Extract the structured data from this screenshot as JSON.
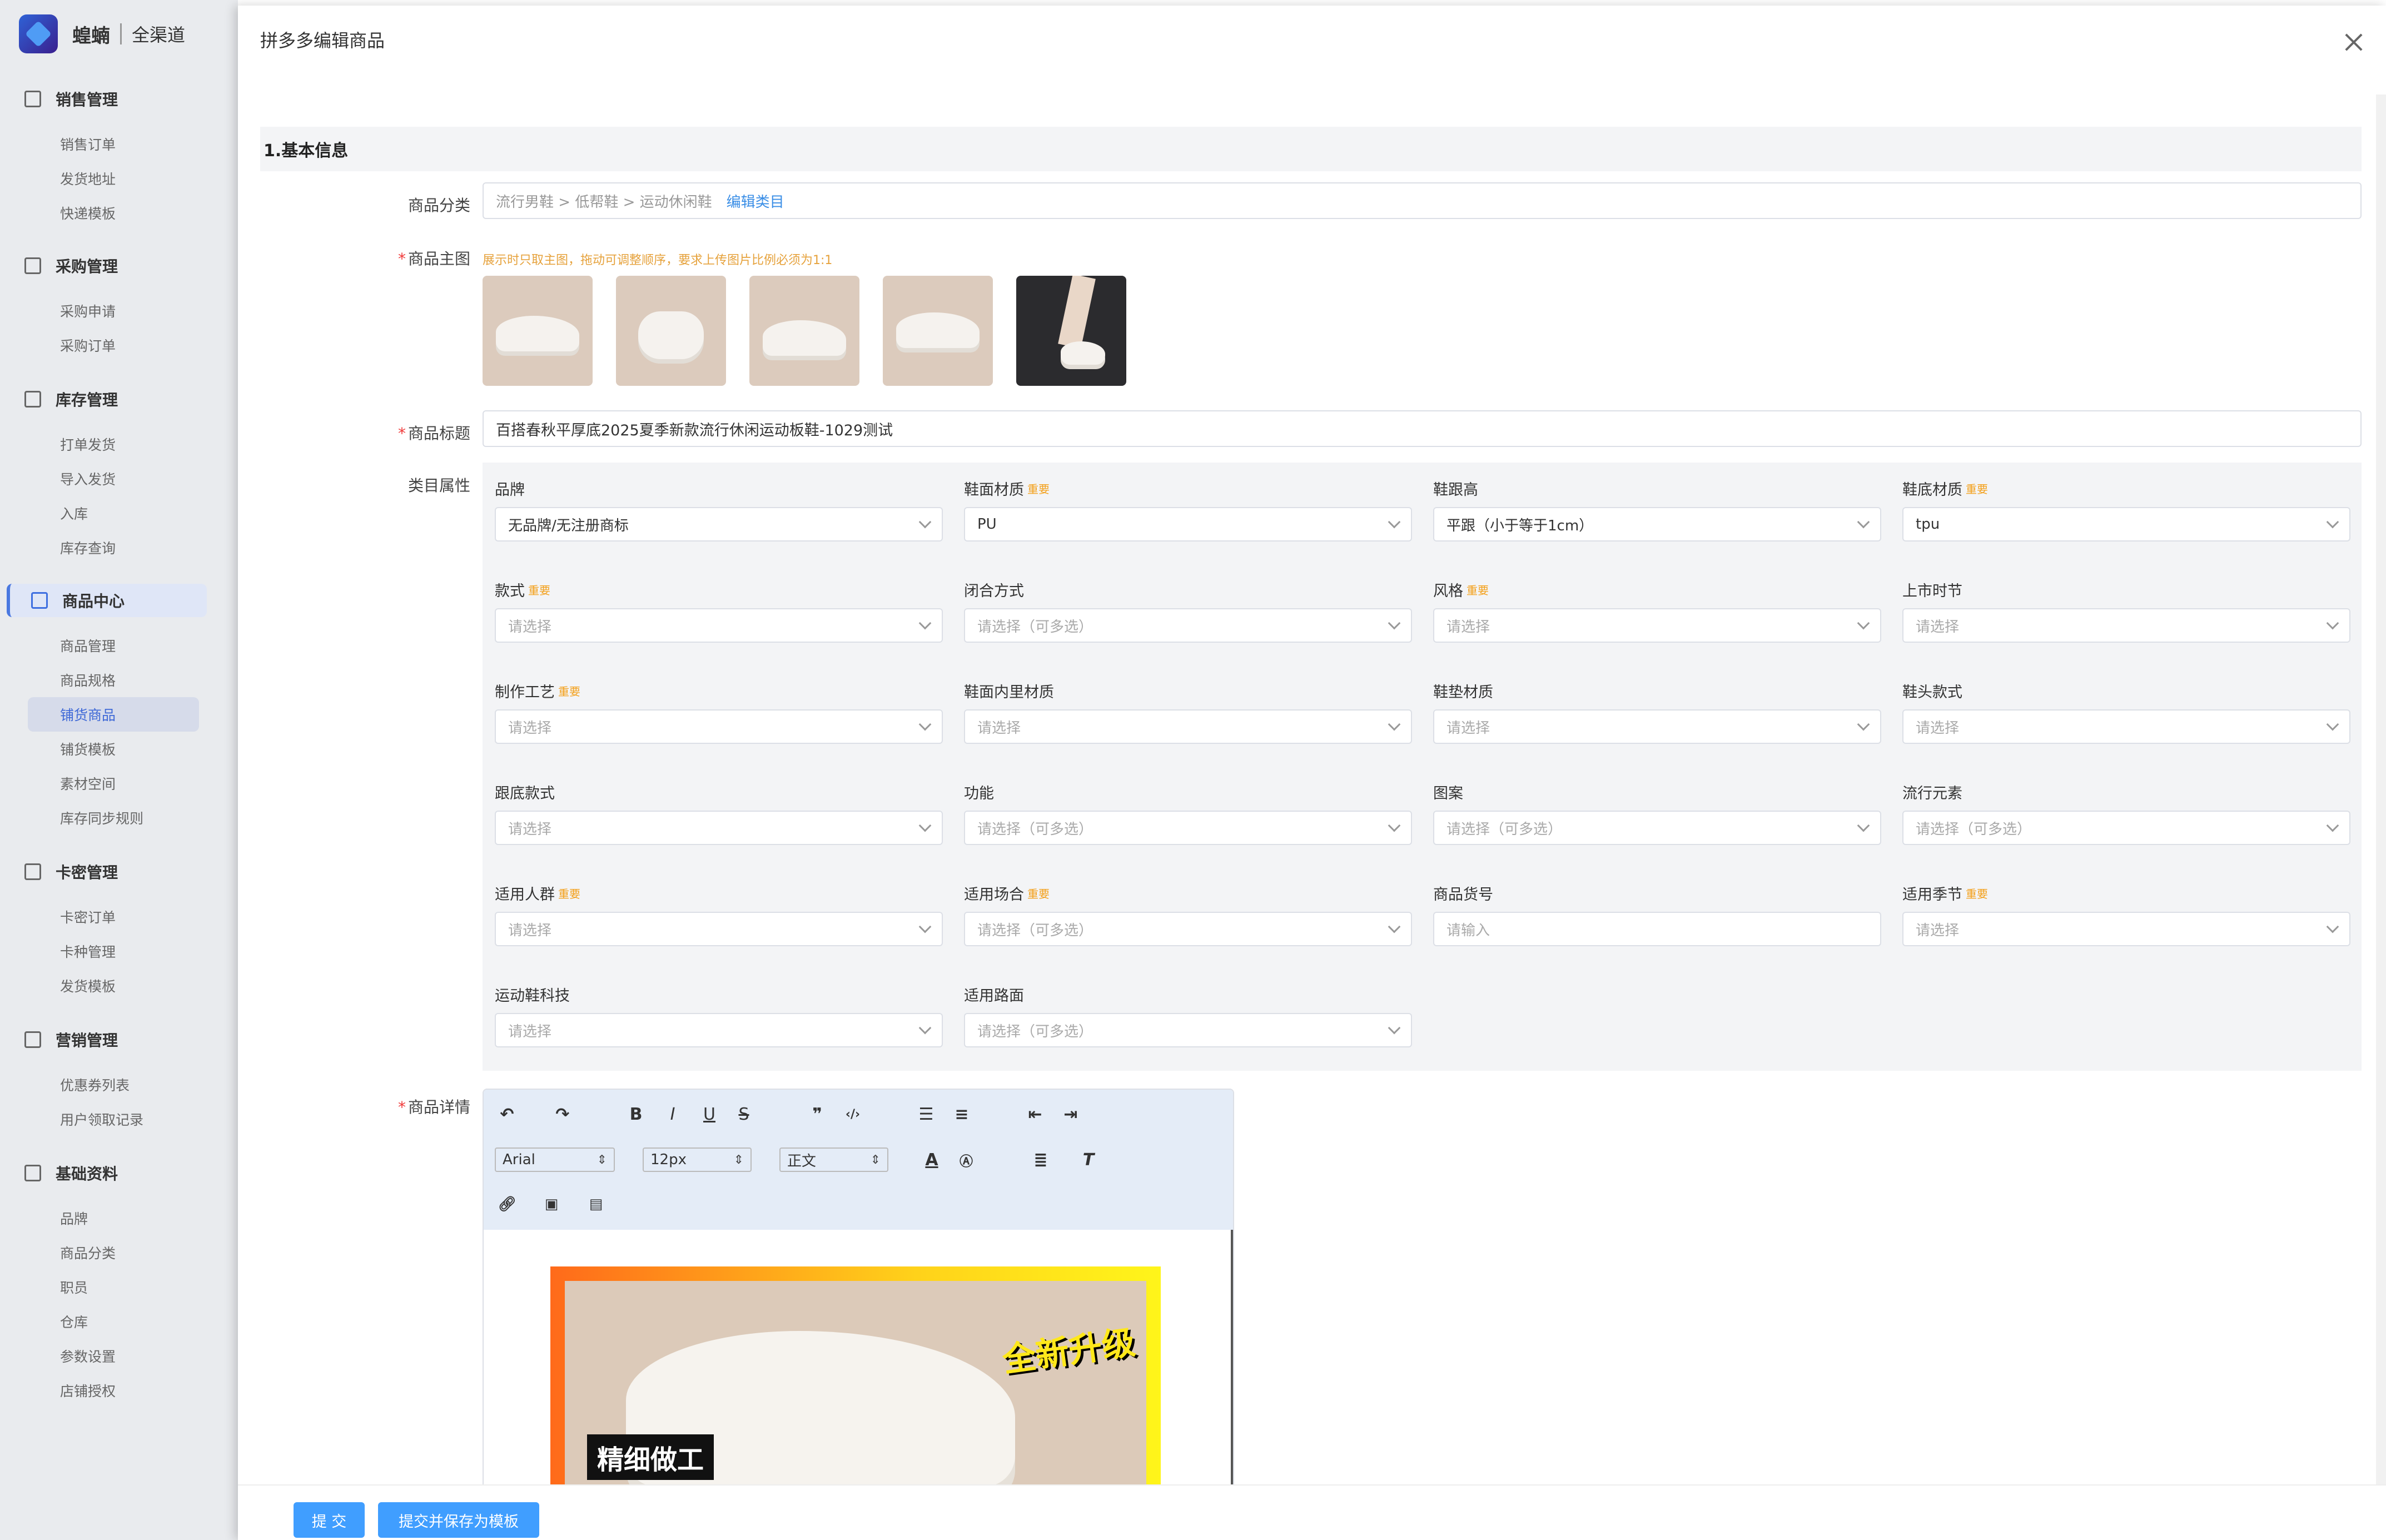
{
  "sidebar": {
    "brand": "蝗蝻",
    "sub": "全渠道",
    "groups": [
      {
        "title": "销售管理",
        "items": [
          "销售订单",
          "发货地址",
          "快递模板"
        ]
      },
      {
        "title": "采购管理",
        "items": [
          "采购申请",
          "采购订单"
        ]
      },
      {
        "title": "库存管理",
        "items": [
          "打单发货",
          "导入发货",
          "入库",
          "库存查询"
        ]
      },
      {
        "title": "商品中心",
        "items": [
          "商品管理",
          "商品规格",
          "铺货商品",
          "铺货模板",
          "素材空间",
          "库存同步规则"
        ]
      },
      {
        "title": "卡密管理",
        "items": [
          "卡密订单",
          "卡种管理",
          "发货模板"
        ]
      },
      {
        "title": "营销管理",
        "items": [
          "优惠券列表",
          "用户领取记录"
        ]
      },
      {
        "title": "基础资料",
        "items": [
          "品牌",
          "商品分类",
          "职员",
          "仓库",
          "参数设置",
          "店铺授权"
        ]
      }
    ]
  },
  "panel": {
    "title": "拼多多编辑商品",
    "section1": "1.基本信息",
    "category_label": "商品分类",
    "category_path": "流行男鞋 > 低帮鞋 > 运动休闲鞋",
    "category_edit": "编辑类目",
    "main_image_label": "商品主图",
    "main_image_hint": "展示时只取主图，拖动可调整顺序，要求上传图片比例必须为1:1",
    "title_label": "商品标题",
    "title_value": "百搭春秋平厚底2025夏季新款流行休闲运动板鞋-1029测试",
    "attr_label": "类目属性",
    "important": "重要",
    "detail_label": "商品详情",
    "attrs": [
      {
        "label": "品牌",
        "value": "无品牌/无注册商标",
        "placeholder": false,
        "important": false
      },
      {
        "label": "鞋面材质",
        "value": "PU",
        "placeholder": false,
        "important": true
      },
      {
        "label": "鞋跟高",
        "value": "平跟（小于等于1cm）",
        "placeholder": false,
        "important": false
      },
      {
        "label": "鞋底材质",
        "value": "tpu",
        "placeholder": false,
        "important": true
      },
      {
        "label": "款式",
        "value": "请选择",
        "placeholder": true,
        "important": true
      },
      {
        "label": "闭合方式",
        "value": "请选择（可多选）",
        "placeholder": true,
        "important": false
      },
      {
        "label": "风格",
        "value": "请选择",
        "placeholder": true,
        "important": true
      },
      {
        "label": "上市时节",
        "value": "请选择",
        "placeholder": true,
        "important": false
      },
      {
        "label": "制作工艺",
        "value": "请选择",
        "placeholder": true,
        "important": true
      },
      {
        "label": "鞋面内里材质",
        "value": "请选择",
        "placeholder": true,
        "important": false
      },
      {
        "label": "鞋垫材质",
        "value": "请选择",
        "placeholder": true,
        "important": false
      },
      {
        "label": "鞋头款式",
        "value": "请选择",
        "placeholder": true,
        "important": false
      },
      {
        "label": "跟底款式",
        "value": "请选择",
        "placeholder": true,
        "important": false
      },
      {
        "label": "功能",
        "value": "请选择（可多选）",
        "placeholder": true,
        "important": false
      },
      {
        "label": "图案",
        "value": "请选择（可多选）",
        "placeholder": true,
        "important": false
      },
      {
        "label": "流行元素",
        "value": "请选择（可多选）",
        "placeholder": true,
        "important": false
      },
      {
        "label": "适用人群",
        "value": "请选择",
        "placeholder": true,
        "important": true
      },
      {
        "label": "适用场合",
        "value": "请选择（可多选）",
        "placeholder": true,
        "important": true
      },
      {
        "label": "商品货号",
        "value": "请输入",
        "placeholder": true,
        "important": false,
        "input": true
      },
      {
        "label": "适用季节",
        "value": "请选择",
        "placeholder": true,
        "important": true
      },
      {
        "label": "运动鞋科技",
        "value": "请选择",
        "placeholder": true,
        "important": false
      },
      {
        "label": "适用路面",
        "value": "请选择（可多选）",
        "placeholder": true,
        "important": false
      }
    ],
    "editor": {
      "font": "Arial",
      "size": "12px",
      "block": "正文",
      "promo_tag": "精细做工",
      "promo_badge": "全新升级"
    },
    "footer": {
      "submit": "提 交",
      "submit_template": "提交并保存为模板"
    }
  },
  "colors": {
    "primary": "#409eff",
    "link": "#3a8ee6",
    "hint": "#e6a23c",
    "important": "#f3a01b",
    "required": "#f03b3b"
  }
}
